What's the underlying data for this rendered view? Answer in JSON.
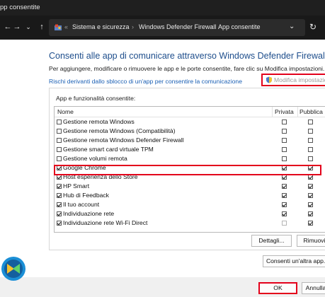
{
  "window": {
    "title": "pp consentite"
  },
  "nav": {
    "back_icon": "arrow-left-icon",
    "forward_icon": "arrow-right-icon",
    "recent_icon": "chevron-down-icon",
    "up_icon": "arrow-up-icon",
    "refresh_icon": "refresh-icon"
  },
  "address": {
    "overflow": "«",
    "crumbs": [
      "Sistema e sicurezza",
      "Windows Defender Firewall",
      "App consentite"
    ]
  },
  "main": {
    "heading": "Consenti alle app di comunicare attraverso Windows Defender Firewall",
    "subtext": "Per aggiungere, modificare o rimuovere le app e le porte consentite, fare clic su Modifica impostazioni.",
    "risk_link": "Rischi derivanti dallo sblocco di un'app per consentire la comunicazione",
    "modify_label": "Modifica impostazioni"
  },
  "group": {
    "title": "App e funzionalità consentite:",
    "columns": {
      "name": "Nome",
      "private": "Privata",
      "public": "Pubblica"
    },
    "rows": [
      {
        "name": "Gestione remota Windows",
        "checked": false,
        "private": false,
        "public": false
      },
      {
        "name": "Gestione remota Windows (Compatibilità)",
        "checked": false,
        "private": false,
        "public": false
      },
      {
        "name": "Gestione remota Windows Defender Firewall",
        "checked": false,
        "private": false,
        "public": false
      },
      {
        "name": "Gestione smart card virtuale TPM",
        "checked": false,
        "private": false,
        "public": false
      },
      {
        "name": "Gestione volumi remota",
        "checked": false,
        "private": false,
        "public": false
      },
      {
        "name": "Google Chrome",
        "checked": true,
        "private": true,
        "public": true
      },
      {
        "name": "Host esperienza dello Store",
        "checked": true,
        "private": true,
        "public": true
      },
      {
        "name": "HP Smart",
        "checked": true,
        "private": true,
        "public": true
      },
      {
        "name": "Hub di Feedback",
        "checked": true,
        "private": true,
        "public": true
      },
      {
        "name": "Il tuo account",
        "checked": true,
        "private": true,
        "public": true
      },
      {
        "name": "Individuazione rete",
        "checked": true,
        "private": true,
        "public": true
      },
      {
        "name": "Individuazione rete Wi-Fi Direct",
        "checked": true,
        "private": false,
        "public": true
      }
    ],
    "details_button": "Dettagli...",
    "remove_button": "Rimuovi"
  },
  "allow_other_button": "Consenti un'altra app...",
  "footer": {
    "ok_label": "OK",
    "cancel_label": "Annulla"
  },
  "colors": {
    "accent_red": "#e3001b",
    "heading_blue": "#1e4e8c",
    "link_blue": "#1a5fb4"
  }
}
